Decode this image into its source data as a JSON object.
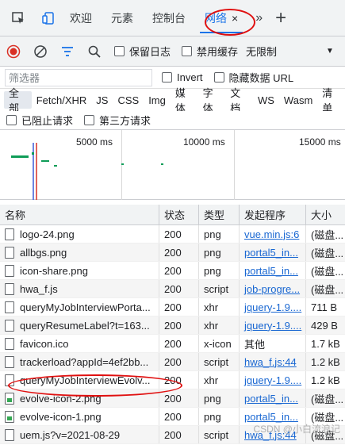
{
  "tabs": [
    {
      "label": "欢迎",
      "active": false
    },
    {
      "label": "元素",
      "active": false
    },
    {
      "label": "控制台",
      "active": false
    },
    {
      "label": "网络",
      "active": true
    }
  ],
  "tab_more": "»",
  "tab_add": "+",
  "tab_close": "×",
  "toolbar": {
    "preserve_log": "保留日志",
    "disable_cache": "禁用缓存",
    "throttling": "无限制"
  },
  "filter": {
    "placeholder": "筛选器",
    "invert": "Invert",
    "hide_data_urls": "隐藏数据 URL"
  },
  "type_filters": [
    "全部",
    "Fetch/XHR",
    "JS",
    "CSS",
    "Img",
    "媒体",
    "字体",
    "文档",
    "WS",
    "Wasm",
    "清单"
  ],
  "blocked_requests": "已阻止请求",
  "third_party_requests": "第三方请求",
  "timeline": {
    "ticks": [
      "5000 ms",
      "10000 ms",
      "15000 ms"
    ]
  },
  "columns": {
    "name": "名称",
    "status": "状态",
    "type": "类型",
    "initiator": "发起程序",
    "size": "大小"
  },
  "rows": [
    {
      "name": "logo-24.png",
      "status": "200",
      "type": "png",
      "initiator": "vue.min.js:6",
      "size": "(磁盘...",
      "img": false
    },
    {
      "name": "allbgs.png",
      "status": "200",
      "type": "png",
      "initiator": "portal5_in...",
      "size": "(磁盘...",
      "img": false
    },
    {
      "name": "icon-share.png",
      "status": "200",
      "type": "png",
      "initiator": "portal5_in...",
      "size": "(磁盘...",
      "img": false
    },
    {
      "name": "hwa_f.js",
      "status": "200",
      "type": "script",
      "initiator": "job-progre...",
      "size": "(磁盘...",
      "img": false
    },
    {
      "name": "queryMyJobInterviewPorta...",
      "status": "200",
      "type": "xhr",
      "initiator": "jquery-1.9....",
      "size": "711 B",
      "img": false
    },
    {
      "name": "queryResumeLabel?t=163...",
      "status": "200",
      "type": "xhr",
      "initiator": "jquery-1.9....",
      "size": "429 B",
      "img": false
    },
    {
      "name": "favicon.ico",
      "status": "200",
      "type": "x-icon",
      "initiator": "其他",
      "size": "1.7 kB",
      "img": false
    },
    {
      "name": "trackerload?appId=4ef2bb...",
      "status": "200",
      "type": "script",
      "initiator": "hwa_f.js:44",
      "size": "1.2 kB",
      "img": false
    },
    {
      "name": "queryMyJobInterviewEvolv...",
      "status": "200",
      "type": "xhr",
      "initiator": "jquery-1.9....",
      "size": "1.2 kB",
      "img": false
    },
    {
      "name": "evolve-icon-2.png",
      "status": "200",
      "type": "png",
      "initiator": "portal5_in...",
      "size": "(磁盘...",
      "img": true
    },
    {
      "name": "evolve-icon-1.png",
      "status": "200",
      "type": "png",
      "initiator": "portal5_in...",
      "size": "(磁盘...",
      "img": true
    },
    {
      "name": "uem.js?v=2021-08-29",
      "status": "200",
      "type": "script",
      "initiator": "hwa_f.js:44",
      "size": "(磁盘...",
      "img": false
    }
  ],
  "watermark": "CSDN @小白流浪记"
}
